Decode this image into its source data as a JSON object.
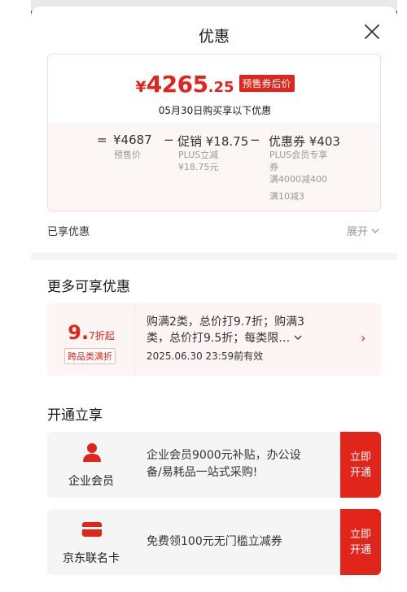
{
  "sheet": {
    "title": "优惠"
  },
  "price": {
    "yen": "¥",
    "integer": "4265",
    "decimal": ".25",
    "tag": "预售券后价",
    "date_text": "05月30日购买享以下优惠"
  },
  "calc": {
    "eq": "=",
    "base_value": "¥4687",
    "base_label": "预售价",
    "minus1": "−",
    "promo_value": "促销 ¥18.75",
    "promo_sub1": "PLUS立减",
    "promo_sub2": "¥18.75元",
    "minus2": "−",
    "coupon_value": "优惠券 ¥403",
    "coupon_sub1": "PLUS会员专享",
    "coupon_sub2": "券",
    "coupon_sub3": "满4000减400",
    "coupon_sub4": "满10减3"
  },
  "enjoyed": {
    "label": "已享优惠",
    "expand": "展开"
  },
  "more": {
    "title": "更多可享优惠",
    "rate_big": "9.",
    "rate_small": "7折起",
    "tag": "跨品类满折",
    "desc_line1": "购满2类，总价打9.7折；购满3",
    "desc_line2": "类，总价打9.5折；每类限…",
    "valid": "2025.06.30 23:59前有效",
    "arrow": "›"
  },
  "open": {
    "title": "开通立享",
    "cards": [
      {
        "name": "企业会员",
        "desc_line1": "企业会员9000元补贴，办公设",
        "desc_line2": "备/易耗品一站式采购!",
        "button": "立即开通"
      },
      {
        "name": "京东联名卡",
        "desc_line1": "免费领100元无门槛立减券",
        "button": "立即开通"
      }
    ]
  },
  "colors": {
    "accent": "#e1251b",
    "card_bg": "#f5f5f5",
    "promo_bg": "#fdf4f4"
  },
  "icons": [
    "close-icon",
    "chevron-down-icon",
    "chevron-right-icon",
    "person-icon",
    "card-icon"
  ]
}
